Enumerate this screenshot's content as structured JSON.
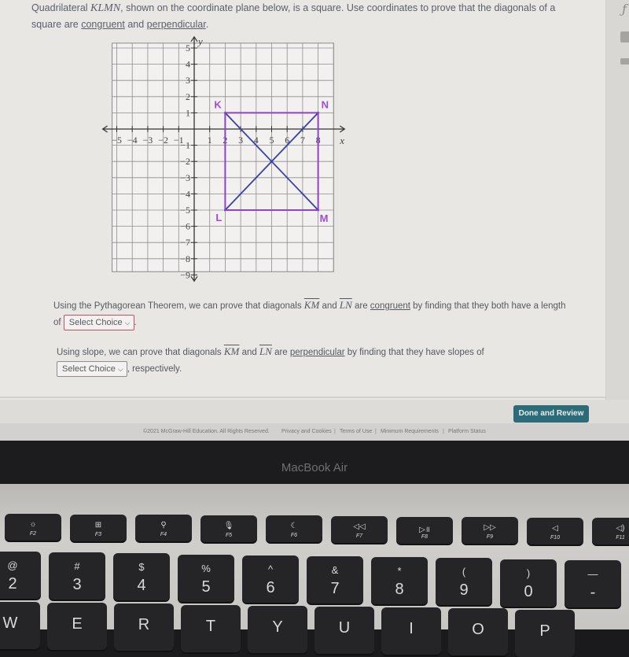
{
  "prompt": {
    "part1": "Quadrilateral ",
    "shape_name": "KLMN",
    "part2": ", shown on the coordinate plane below, is a square. Use coordinates to prove that the diagonals of a square are ",
    "congruent": "congruent",
    "and": " and ",
    "perpendicular": "perpendicular",
    "end": "."
  },
  "chart_data": {
    "type": "scatter",
    "title": "",
    "xlabel": "x",
    "ylabel": "y",
    "xlim": [
      -5.3,
      9.0
    ],
    "ylim": [
      -8.8,
      5.3
    ],
    "grid": true,
    "x_tick_labels": [
      "−5",
      "−4",
      "−3",
      "−2",
      "−1",
      "1",
      "2",
      "3",
      "4",
      "5",
      "6",
      "7",
      "8"
    ],
    "x_ticks": [
      -5,
      -4,
      -3,
      -2,
      -1,
      1,
      2,
      3,
      4,
      5,
      6,
      7,
      8
    ],
    "y_tick_labels": [
      "5",
      "4",
      "3",
      "2",
      "1",
      "−1",
      "−2",
      "−3",
      "−4",
      "−5",
      "−6",
      "−7",
      "−8",
      "−9"
    ],
    "y_ticks": [
      5,
      4,
      3,
      2,
      1,
      -1,
      -2,
      -3,
      -4,
      -5,
      -6,
      -7,
      -8,
      -9
    ],
    "points": [
      {
        "label": "K",
        "x": 2,
        "y": 1
      },
      {
        "label": "L",
        "x": 2,
        "y": -5
      },
      {
        "label": "M",
        "x": 8,
        "y": -5
      },
      {
        "label": "N",
        "x": 8,
        "y": 1
      }
    ],
    "polygon": [
      "K",
      "L",
      "M",
      "N"
    ],
    "diagonals": [
      [
        "K",
        "M"
      ],
      [
        "L",
        "N"
      ]
    ],
    "colors": {
      "square": "#8e44c8",
      "diagonal": "#3a3fa8",
      "label": "#9b4fd0"
    }
  },
  "q1": {
    "text1": "Using the Pythagorean Theorem, we can prove that diagonals ",
    "seg1": "KM",
    "and": " and ",
    "seg2": "LN",
    "text2": " are ",
    "congruent": "congruent",
    "text3": " by finding that they both have a length of ",
    "select_value": "Select Choice",
    "end": "."
  },
  "q2": {
    "text1": "Using slope, we can prove that diagonals ",
    "seg1": "KM",
    "and": " and ",
    "seg2": "LN",
    "text2": " are ",
    "perpendicular": "perpendicular",
    "text3": " by finding that they have slopes of ",
    "select_value": "Select Choice",
    "end": ", respectively."
  },
  "footer": {
    "done_button": "Done and Review",
    "copyright": "©2021 McGraw-Hill Education. All Rights Reserved.",
    "links": [
      "Privacy and Cookies",
      "Terms of Use",
      "Minimum Requirements",
      "Platform Status"
    ]
  },
  "laptop": {
    "brand": "MacBook Air",
    "fn_keys": [
      {
        "icon": "☼",
        "label": "F2"
      },
      {
        "icon": "⊞",
        "label": "F3"
      },
      {
        "icon": "⚲",
        "label": "F4"
      },
      {
        "icon": "🎙",
        "label": "F5"
      },
      {
        "icon": "☾",
        "label": "F6"
      },
      {
        "icon": "◁◁",
        "label": "F7"
      },
      {
        "icon": "▷॥",
        "label": "F8"
      },
      {
        "icon": "▷▷",
        "label": "F9"
      },
      {
        "icon": "◁",
        "label": "F10"
      },
      {
        "icon": "◁)",
        "label": "F11"
      }
    ],
    "num_keys": [
      {
        "top": "@",
        "bot": "2"
      },
      {
        "top": "#",
        "bot": "3"
      },
      {
        "top": "$",
        "bot": "4"
      },
      {
        "top": "%",
        "bot": "5"
      },
      {
        "top": "^",
        "bot": "6"
      },
      {
        "top": "&",
        "bot": "7"
      },
      {
        "top": "*",
        "bot": "8"
      },
      {
        "top": "(",
        "bot": "9"
      },
      {
        "top": ")",
        "bot": "0"
      },
      {
        "top": "—",
        "bot": "-"
      }
    ],
    "letter_keys": [
      "W",
      "E",
      "R",
      "T",
      "Y",
      "U",
      "I",
      "O",
      "P"
    ]
  }
}
